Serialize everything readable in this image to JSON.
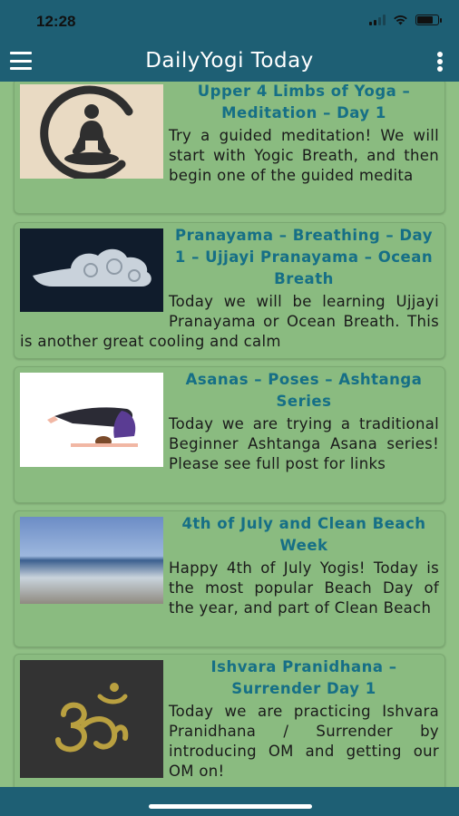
{
  "status": {
    "time": "12:28"
  },
  "appbar": {
    "title": "DailyYogi Today"
  },
  "posts": [
    {
      "title": "Upper 4 Limbs of Yoga – Meditation – Day 1",
      "excerpt": "Try a guided meditation! We will start with Yogic Breath, and then begin one of the guided medita",
      "image": "meditation-figure"
    },
    {
      "title": "Pranayama – Breathing – Day 1 – Ujjayi Pranayama – Ocean Breath",
      "excerpt": "Today we will be learning Ujjayi Pranayama or Ocean Breath. This is another great cooling and calm",
      "image": "cloud-swirl"
    },
    {
      "title": "Asanas – Poses – Ashtanga Series",
      "excerpt": "Today we are trying a traditional Beginner Ashtanga Asana series! Please see full post for links",
      "image": "plow-pose"
    },
    {
      "title": "4th of July and Clean Beach Week",
      "excerpt": "Happy 4th of July Yogis! Today is the most popular Beach Day of the year, and part of Clean Beach",
      "image": "beach-waves"
    },
    {
      "title": "Ishvara Pranidhana – Surrender Day 1",
      "excerpt": "Today we are practicing Ishvara Pranidhana / Surrender by introducing OM and getting our OM on!",
      "image": "om-symbol"
    }
  ],
  "colors": {
    "bar": "#1e5f74",
    "background": "#8fbf84",
    "title": "#166f86"
  }
}
